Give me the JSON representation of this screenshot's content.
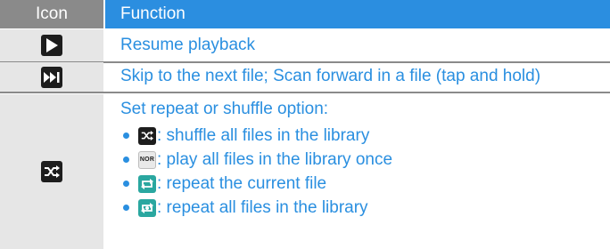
{
  "table": {
    "headers": {
      "icon": "Icon",
      "function": "Function"
    },
    "rows": [
      {
        "icon": "play-icon",
        "text": "Resume playback"
      },
      {
        "icon": "skip-next-icon",
        "text": "Skip to the next file; Scan forward in a file (tap and hold)"
      },
      {
        "icon": "shuffle-icon",
        "text": "Set repeat or shuffle option:",
        "options": [
          {
            "icon": "shuffle-icon",
            "text": ": shuffle all files in the library"
          },
          {
            "icon": "nor-icon",
            "icon_label": "NOR",
            "text": ": play all files in the library once"
          },
          {
            "icon": "repeat-one-icon",
            "text": ": repeat the current file"
          },
          {
            "icon": "repeat-all-icon",
            "text": ": repeat all files in the library"
          }
        ]
      }
    ]
  },
  "colors": {
    "header_icon_bg": "#8a8a8a",
    "header_function_bg": "#2b8ee0",
    "icon_cell_bg": "#e6e6e6",
    "text": "#2a8fe0",
    "button_bg": "#1d1d1d",
    "repeat_button_bg": "#2aa7a0"
  }
}
